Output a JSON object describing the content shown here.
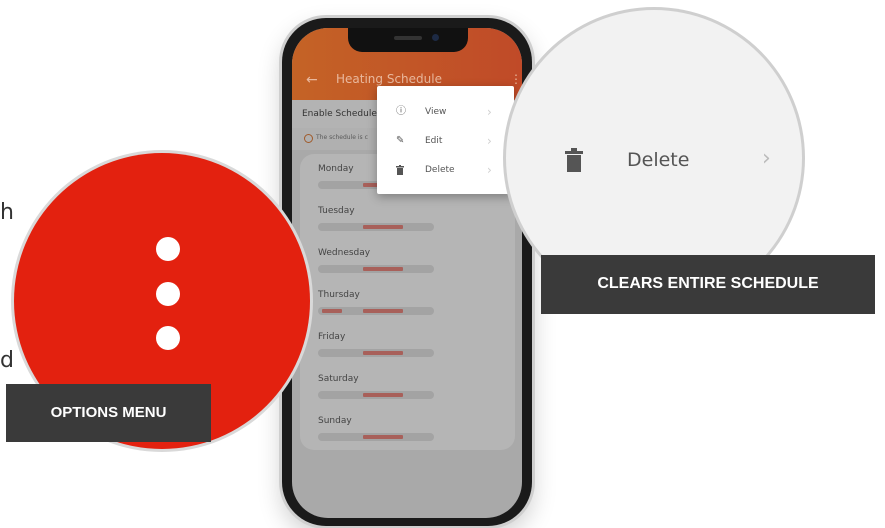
{
  "fragments": {
    "top": "h",
    "bottom": "d"
  },
  "app": {
    "title": "Heating Schedule",
    "back_icon": "arrow-left-icon",
    "options_icon": "more-vert-icon",
    "enable_label": "Enable Schedule",
    "info_text": "The schedule is c"
  },
  "days": [
    {
      "name": "Monday"
    },
    {
      "name": "Tuesday"
    },
    {
      "name": "Wednesday"
    },
    {
      "name": "Thursday"
    },
    {
      "name": "Friday"
    },
    {
      "name": "Saturday"
    },
    {
      "name": "Sunday"
    }
  ],
  "menu": {
    "items": [
      {
        "label": "View",
        "icon": "info-icon"
      },
      {
        "label": "Edit",
        "icon": "pencil-icon"
      },
      {
        "label": "Delete",
        "icon": "trash-icon"
      }
    ]
  },
  "callouts": {
    "options_menu": "OPTIONS MENU",
    "delete_item": "Delete",
    "clears": "CLEARS ENTIRE SCHEDULE"
  },
  "colors": {
    "accent": "#e3210f",
    "appbar": "#c46326",
    "callout_bg": "#3a3a3a"
  }
}
